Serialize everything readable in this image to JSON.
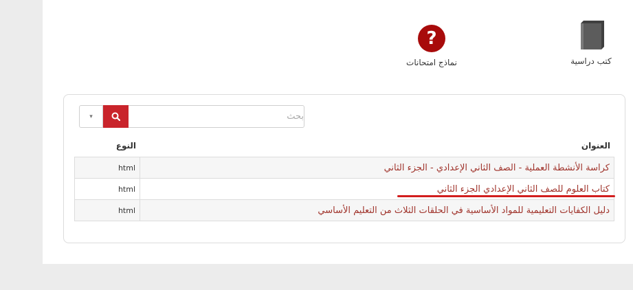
{
  "categories": [
    {
      "label": "كتب دراسية",
      "icon": "book-icon"
    },
    {
      "label": "نماذج امتحانات",
      "icon": "question-icon",
      "icon_text": "?"
    }
  ],
  "search": {
    "placeholder": "بحث",
    "dropdown_arrow": "▾"
  },
  "table": {
    "headers": {
      "title": "العنوان",
      "type": "النوع"
    },
    "rows": [
      {
        "title": "كراسة الأنشطة العملية - الصف الثاني الإعدادي - الجزء الثاني",
        "type": "html"
      },
      {
        "title": "كتاب العلوم للصف الثاني الإعدادي الجزء الثاني",
        "type": "html"
      },
      {
        "title": "دليل الكفايات التعليمية للمواد الأساسية في الحلقات الثلاث من التعليم الأساسي",
        "type": "html"
      }
    ]
  },
  "colors": {
    "accent": "#c9242b",
    "link": "#a0342c",
    "icon_red": "#a80b0b",
    "annotation": "#d21d1d"
  }
}
